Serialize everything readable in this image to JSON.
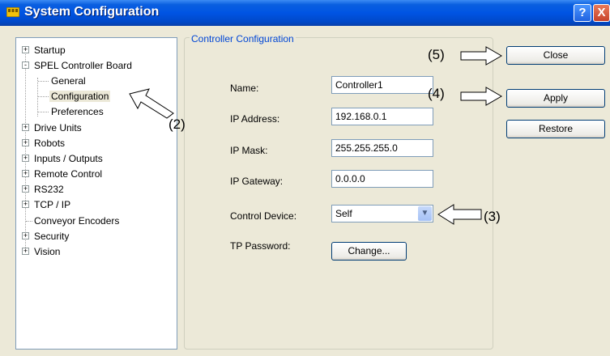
{
  "window": {
    "title": "System Configuration",
    "help_label": "?",
    "close_label": "X"
  },
  "tree": {
    "items": [
      {
        "label": "Startup",
        "expander": "+"
      },
      {
        "label": "SPEL Controller Board",
        "expander": "-"
      },
      {
        "label": "General"
      },
      {
        "label": "Configuration",
        "selected": true
      },
      {
        "label": "Preferences"
      },
      {
        "label": "Drive Units",
        "expander": "+"
      },
      {
        "label": "Robots",
        "expander": "+"
      },
      {
        "label": "Inputs / Outputs",
        "expander": "+"
      },
      {
        "label": "Remote Control",
        "expander": "+"
      },
      {
        "label": "RS232",
        "expander": "+"
      },
      {
        "label": "TCP / IP",
        "expander": "+"
      },
      {
        "label": "Conveyor Encoders"
      },
      {
        "label": "Security",
        "expander": "+"
      },
      {
        "label": "Vision",
        "expander": "+"
      }
    ]
  },
  "group": {
    "title": "Controller Configuration",
    "name": {
      "label": "Name:",
      "value": "Controller1"
    },
    "ip_address": {
      "label": "IP Address:",
      "value": "192.168.0.1"
    },
    "ip_mask": {
      "label": "IP Mask:",
      "value": "255.255.255.0"
    },
    "ip_gateway": {
      "label": "IP Gateway:",
      "value": "0.0.0.0"
    },
    "control_device": {
      "label": "Control Device:",
      "value": "Self"
    },
    "tp_password": {
      "label": "TP Password:",
      "button": "Change..."
    }
  },
  "buttons": {
    "close": "Close",
    "apply": "Apply",
    "restore": "Restore"
  },
  "callouts": {
    "c2": "(2)",
    "c3": "(3)",
    "c4": "(4)",
    "c5": "(5)"
  }
}
